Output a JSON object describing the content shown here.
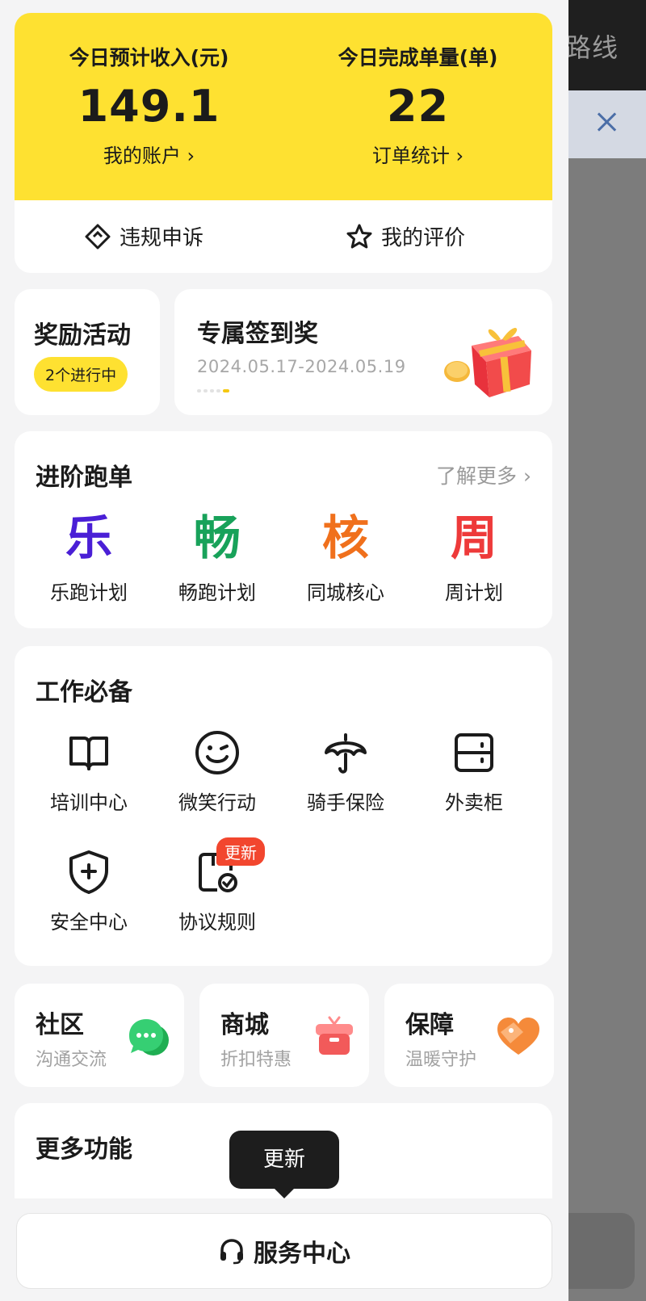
{
  "summary": {
    "income_label": "今日预计收入(元)",
    "income_value": "149.1",
    "account_link": "我的账户",
    "orders_label": "今日完成单量(单)",
    "orders_value": "22",
    "stats_link": "订单统计"
  },
  "quick_actions": {
    "appeal": "违规申诉",
    "rating": "我的评价"
  },
  "rewards": {
    "title": "奖励活动",
    "status": "2个进行中",
    "promo_title": "专属签到奖",
    "promo_dates": "2024.05.17-2024.05.19"
  },
  "advanced": {
    "title": "进阶跑单",
    "more": "了解更多",
    "items": [
      {
        "glyph": "乐",
        "label": "乐跑计划",
        "color": "#4a1fd6"
      },
      {
        "glyph": "畅",
        "label": "畅跑计划",
        "color": "#18a25a"
      },
      {
        "glyph": "核",
        "label": "同城核心",
        "color": "#f0701c"
      },
      {
        "glyph": "周",
        "label": "周计划",
        "color": "#ee3a3a"
      }
    ]
  },
  "work": {
    "title": "工作必备",
    "items": [
      {
        "icon": "book-icon",
        "label": "培训中心"
      },
      {
        "icon": "smile-wink-icon",
        "label": "微笑行动"
      },
      {
        "icon": "umbrella-icon",
        "label": "骑手保险"
      },
      {
        "icon": "locker-icon",
        "label": "外卖柜"
      },
      {
        "icon": "shield-plus-icon",
        "label": "安全中心"
      },
      {
        "icon": "document-check-icon",
        "label": "协议规则"
      }
    ],
    "badge": "更新"
  },
  "tiles": [
    {
      "title": "社区",
      "subtitle": "沟通交流",
      "icon": "chat-bubble-icon",
      "color": "#2ec665"
    },
    {
      "title": "商城",
      "subtitle": "折扣特惠",
      "icon": "gift-box-icon",
      "color": "#f36b6b"
    },
    {
      "title": "保障",
      "subtitle": "温暖守护",
      "icon": "heart-tag-icon",
      "color": "#f58a3a"
    }
  ],
  "more_features": {
    "title": "更多功能",
    "tooltip": "更新"
  },
  "service_center": {
    "label": "服务中心",
    "icon": "headset-icon"
  },
  "background": {
    "title_fragment": "路线"
  },
  "colors": {
    "brand_yellow": "#fee131",
    "badge_red": "#f2462e"
  }
}
